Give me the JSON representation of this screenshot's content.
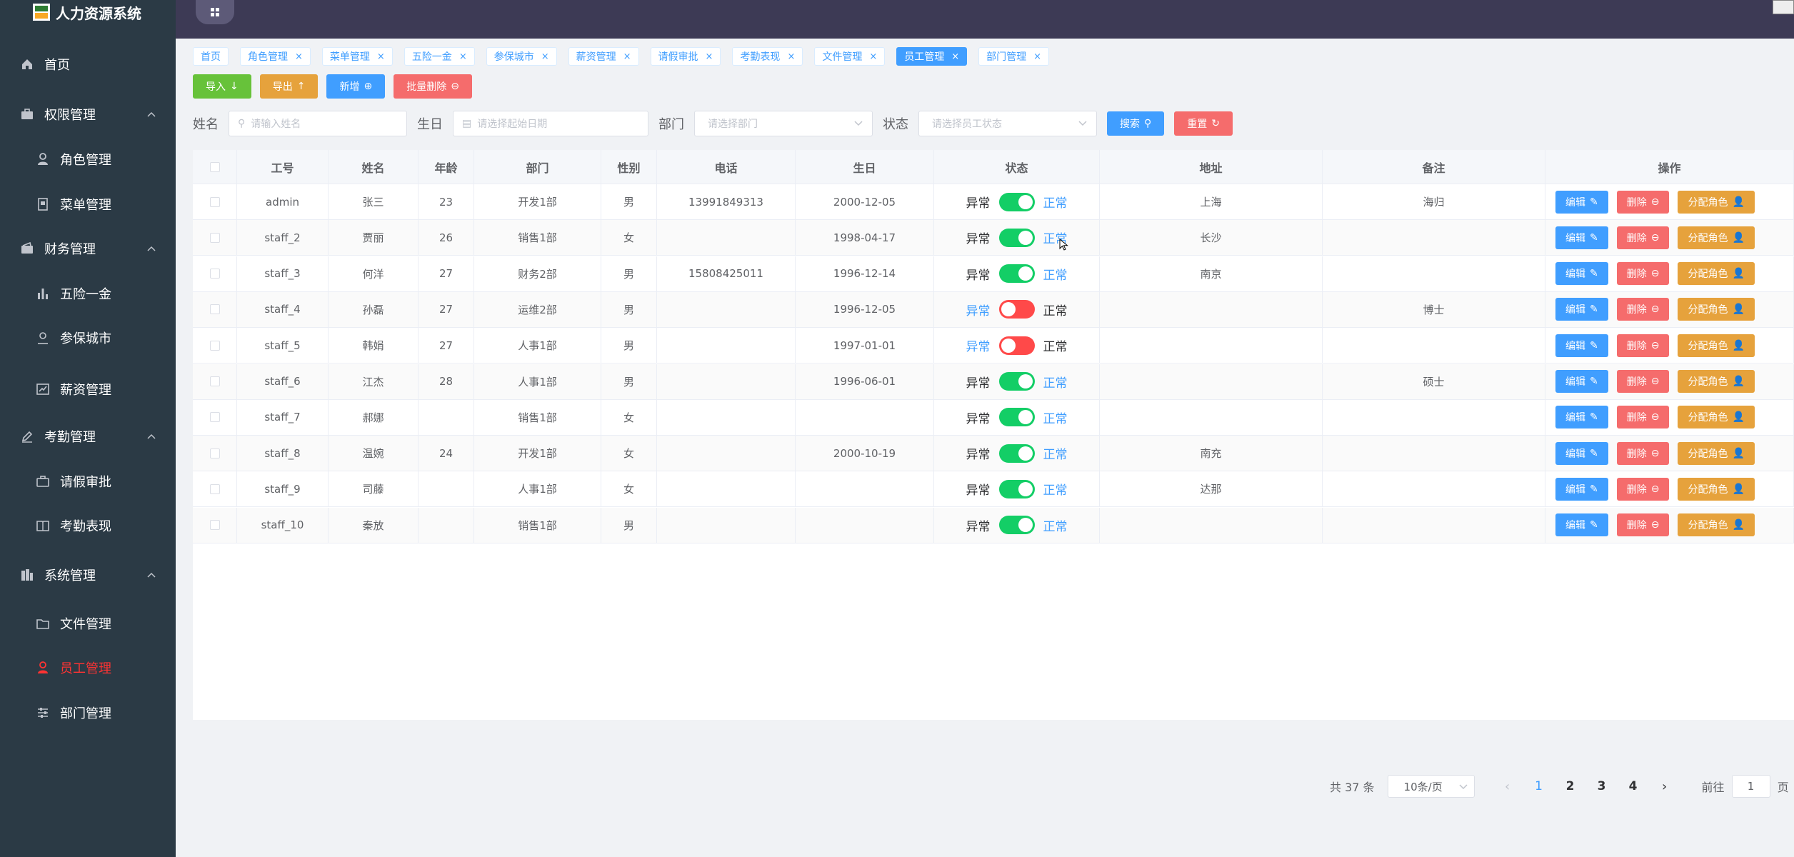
{
  "app": {
    "title": "人力资源系统"
  },
  "sidebar": {
    "items": [
      {
        "label": "首页",
        "icon": "home-icon",
        "level": "top"
      },
      {
        "label": "权限管理",
        "icon": "briefcase-icon",
        "level": "top",
        "expanded": true
      },
      {
        "label": "角色管理",
        "icon": "user-icon",
        "level": "sub"
      },
      {
        "label": "菜单管理",
        "icon": "menu-doc-icon",
        "level": "sub"
      },
      {
        "label": "财务管理",
        "icon": "wallet-icon",
        "level": "top",
        "expanded": true
      },
      {
        "label": "五险一金",
        "icon": "bar-chart-icon",
        "level": "sub"
      },
      {
        "label": "参保城市",
        "icon": "person-pin-icon",
        "level": "sub"
      },
      {
        "label": "薪资管理",
        "icon": "trend-icon",
        "level": "sub"
      },
      {
        "label": "考勤管理",
        "icon": "pen-icon",
        "level": "top",
        "expanded": true
      },
      {
        "label": "请假审批",
        "icon": "suitcase-icon",
        "level": "sub"
      },
      {
        "label": "考勤表现",
        "icon": "book-icon",
        "level": "sub"
      },
      {
        "label": "系统管理",
        "icon": "building-icon",
        "level": "top",
        "expanded": true
      },
      {
        "label": "文件管理",
        "icon": "folder-icon",
        "level": "sub"
      },
      {
        "label": "员工管理",
        "icon": "user-icon",
        "level": "sub",
        "active": true
      },
      {
        "label": "部门管理",
        "icon": "sliders-icon",
        "level": "sub"
      }
    ]
  },
  "tags": [
    {
      "label": "首页",
      "closable": false
    },
    {
      "label": "角色管理",
      "closable": true
    },
    {
      "label": "菜单管理",
      "closable": true
    },
    {
      "label": "五险一金",
      "closable": true
    },
    {
      "label": "参保城市",
      "closable": true
    },
    {
      "label": "薪资管理",
      "closable": true
    },
    {
      "label": "请假审批",
      "closable": true
    },
    {
      "label": "考勤表现",
      "closable": true
    },
    {
      "label": "文件管理",
      "closable": true
    },
    {
      "label": "员工管理",
      "closable": true,
      "active": true
    },
    {
      "label": "部门管理",
      "closable": true
    }
  ],
  "toolbar": {
    "import_label": "导入",
    "export_label": "导出",
    "add_label": "新增",
    "batch_delete_label": "批量删除"
  },
  "search": {
    "name_label": "姓名",
    "name_placeholder": "请输入姓名",
    "birthday_label": "生日",
    "birthday_placeholder": "请选择起始日期",
    "dept_label": "部门",
    "dept_placeholder": "请选择部门",
    "status_label": "状态",
    "status_placeholder": "请选择员工状态",
    "search_btn": "搜索",
    "reset_btn": "重置"
  },
  "table": {
    "columns": [
      "工号",
      "姓名",
      "年龄",
      "部门",
      "性别",
      "电话",
      "生日",
      "状态",
      "地址",
      "备注",
      "操作"
    ],
    "status_off_label": "异常",
    "status_on_label": "正常",
    "edit_label": "编辑",
    "delete_label": "删除",
    "assign_label": "分配角色",
    "rows": [
      {
        "id": "admin",
        "name": "张三",
        "age": "23",
        "dept": "开发1部",
        "gender": "男",
        "phone": "13991849313",
        "birthday": "2000-12-05",
        "status": true,
        "address": "上海",
        "note": "海归"
      },
      {
        "id": "staff_2",
        "name": "贾丽",
        "age": "26",
        "dept": "销售1部",
        "gender": "女",
        "phone": "",
        "birthday": "1998-04-17",
        "status": true,
        "address": "长沙",
        "note": ""
      },
      {
        "id": "staff_3",
        "name": "何洋",
        "age": "27",
        "dept": "财务2部",
        "gender": "男",
        "phone": "15808425011",
        "birthday": "1996-12-14",
        "status": true,
        "address": "南京",
        "note": ""
      },
      {
        "id": "staff_4",
        "name": "孙磊",
        "age": "27",
        "dept": "运维2部",
        "gender": "男",
        "phone": "",
        "birthday": "1996-12-05",
        "status": false,
        "address": "",
        "note": "博士"
      },
      {
        "id": "staff_5",
        "name": "韩娟",
        "age": "27",
        "dept": "人事1部",
        "gender": "男",
        "phone": "",
        "birthday": "1997-01-01",
        "status": false,
        "address": "",
        "note": ""
      },
      {
        "id": "staff_6",
        "name": "江杰",
        "age": "28",
        "dept": "人事1部",
        "gender": "男",
        "phone": "",
        "birthday": "1996-06-01",
        "status": true,
        "address": "",
        "note": "硕士"
      },
      {
        "id": "staff_7",
        "name": "郝娜",
        "age": "",
        "dept": "销售1部",
        "gender": "女",
        "phone": "",
        "birthday": "",
        "status": true,
        "address": "",
        "note": ""
      },
      {
        "id": "staff_8",
        "name": "温婉",
        "age": "24",
        "dept": "开发1部",
        "gender": "女",
        "phone": "",
        "birthday": "2000-10-19",
        "status": true,
        "address": "南充",
        "note": ""
      },
      {
        "id": "staff_9",
        "name": "司藤",
        "age": "",
        "dept": "人事1部",
        "gender": "女",
        "phone": "",
        "birthday": "",
        "status": true,
        "address": "达那",
        "note": ""
      },
      {
        "id": "staff_10",
        "name": "秦放",
        "age": "",
        "dept": "销售1部",
        "gender": "男",
        "phone": "",
        "birthday": "",
        "status": true,
        "address": "",
        "note": ""
      }
    ]
  },
  "pagination": {
    "total_text": "共 37 条",
    "page_size": "10条/页",
    "pages": [
      "1",
      "2",
      "3",
      "4"
    ],
    "current": "1",
    "goto_prefix": "前往",
    "goto_value": "1",
    "goto_suffix": "页"
  },
  "colors": {
    "sidebar_bg": "#2b3a45",
    "topbar_bg": "#3d3a55",
    "primary": "#409eff",
    "success": "#67c23a",
    "warning": "#e6a23c",
    "danger": "#f56c6c",
    "active_menu": "#ff3333"
  }
}
